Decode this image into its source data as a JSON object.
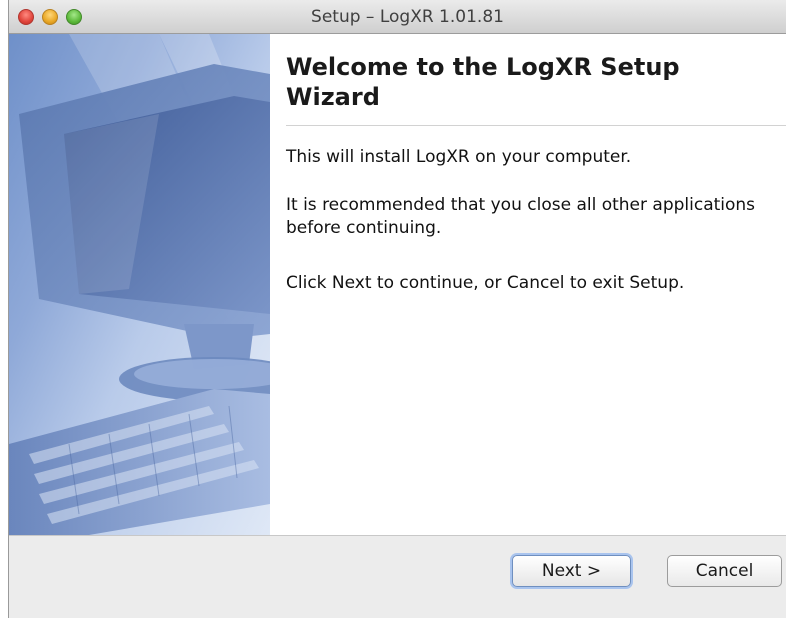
{
  "window": {
    "title": "Setup – LogXR 1.01.81"
  },
  "wizard": {
    "heading": "Welcome to the LogXR Setup Wizard",
    "paragraphs": [
      "This will install LogXR on your computer.",
      "It is recommended that you close all other applications before continuing.",
      "Click Next to continue, or Cancel to exit Setup."
    ]
  },
  "buttons": {
    "next_label": "Next >",
    "cancel_label": "Cancel"
  },
  "icons": {
    "close": "close-icon",
    "minimize": "minimize-icon",
    "zoom": "zoom-icon",
    "banner": "computer-illustration"
  },
  "colors": {
    "banner_blue": "#6f90c9",
    "default_button_ring": "#a9c4ee"
  }
}
